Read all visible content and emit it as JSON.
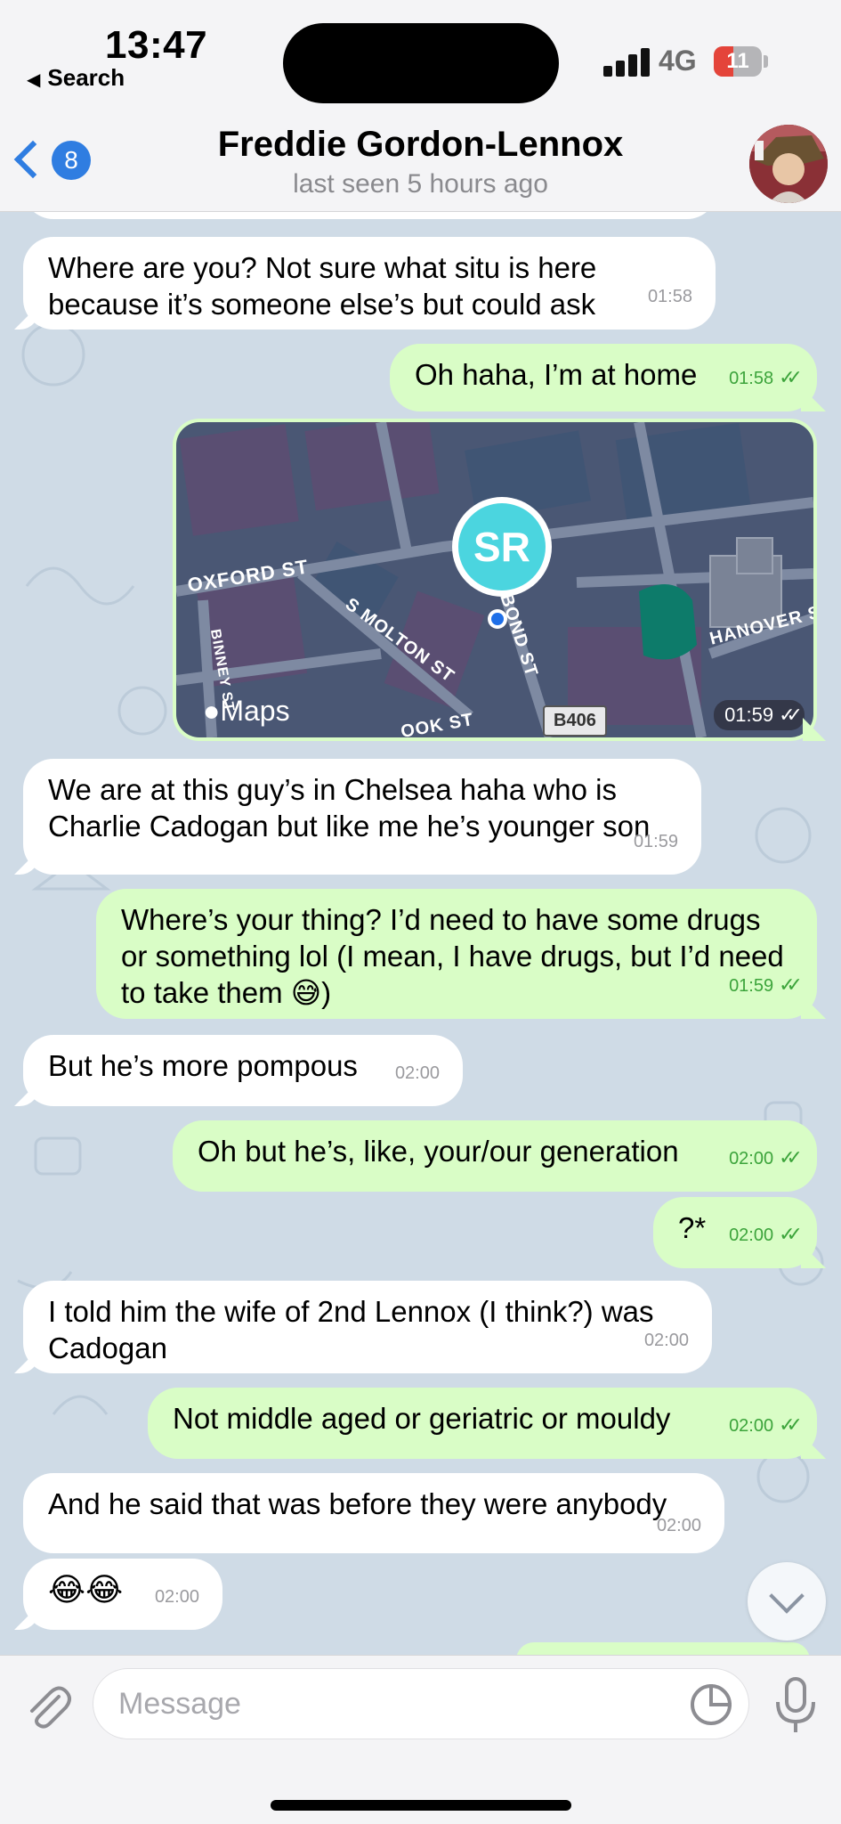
{
  "status_bar": {
    "time": "13:47",
    "back_app": "Search",
    "network": "4G",
    "battery_level": "11",
    "battery_color": "#e4443a"
  },
  "header": {
    "unread_count": "8",
    "contact_name": "Freddie Gordon-Lennox",
    "last_seen": "last seen 5 hours ago"
  },
  "messages": [
    {
      "dir": "in",
      "text": "Where are you? Not sure what situ is here because it’s someone else’s but could ask",
      "time": "01:58"
    },
    {
      "dir": "out",
      "text": "Oh haha, I’m at home",
      "time": "01:58",
      "read": true
    },
    {
      "dir": "out",
      "type": "location",
      "time": "01:59",
      "read": true,
      "map": {
        "initials": "SR",
        "streets": [
          "OXFORD ST",
          "S MOLTON ST",
          "HANOVER ST",
          "BOND ST",
          "OOK ST",
          "BINNEY ST"
        ],
        "road_badge": "B406",
        "provider": "Maps"
      }
    },
    {
      "dir": "in",
      "text": "We are at this guy’s in Chelsea haha who is Charlie Cadogan but like me he’s younger son",
      "time": "01:59"
    },
    {
      "dir": "out",
      "text": "Where’s your thing? I’d need to have some drugs or something lol (I mean, I have drugs, but I’d need to take them 😅)",
      "time": "01:59",
      "read": true
    },
    {
      "dir": "in",
      "text": "But he’s more pompous",
      "time": "02:00"
    },
    {
      "dir": "out",
      "text": "Oh but he’s, like, your/our generation",
      "time": "02:00",
      "read": true
    },
    {
      "dir": "out",
      "text": "?*",
      "time": "02:00",
      "read": true
    },
    {
      "dir": "in",
      "text": "I told him the wife of 2nd Lennox (I think?) was Cadogan",
      "time": "02:00"
    },
    {
      "dir": "out",
      "text": "Not middle aged or geriatric or mouldy",
      "time": "02:00",
      "read": true
    },
    {
      "dir": "in",
      "text": "And he said that was before they were anybody",
      "time": "02:00"
    },
    {
      "dir": "in",
      "text": "😂😂",
      "time": "02:00"
    }
  ],
  "composer": {
    "placeholder": "Message"
  },
  "icons": {
    "back": "chevron-left-icon",
    "attach": "paperclip-icon",
    "sticker": "sticker-icon",
    "mic": "microphone-icon",
    "scroll": "chevron-down-icon"
  },
  "colors": {
    "accent": "#2f7de1",
    "outgoing_bubble": "#d9fdc6",
    "incoming_bubble": "#ffffff",
    "chat_background": "#cfdbe6",
    "read_ticks": "#3ca43b"
  }
}
